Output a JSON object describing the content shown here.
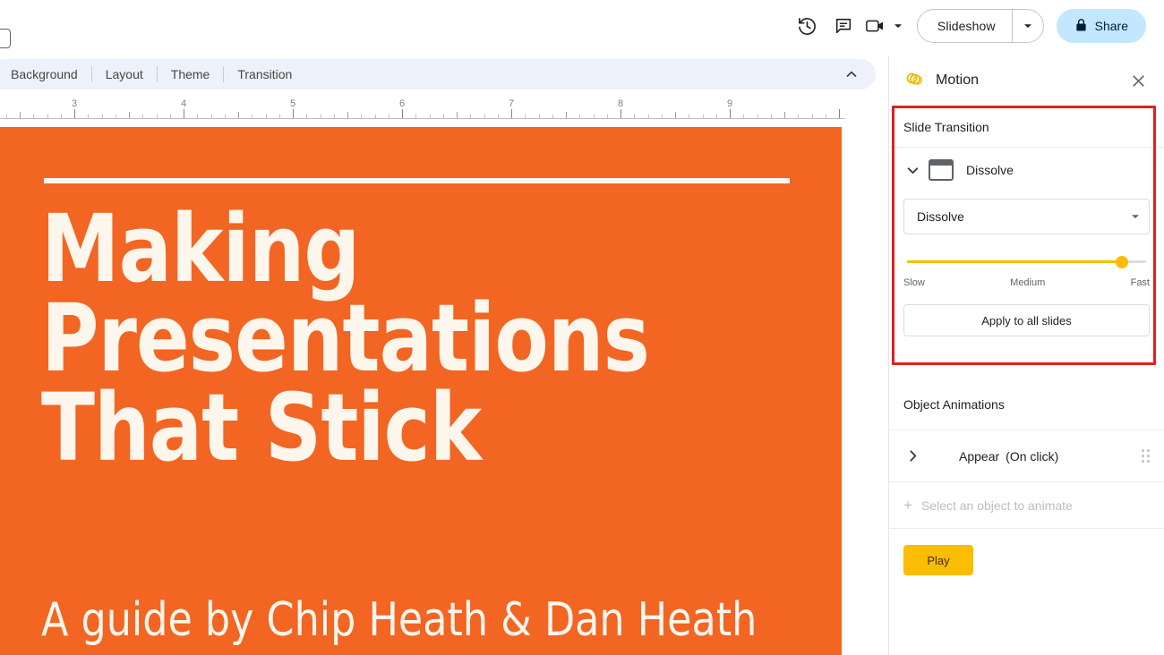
{
  "topbar": {
    "icons": [
      {
        "name": "version-history-icon",
        "label": "Version history"
      },
      {
        "name": "comment-icon",
        "label": "Comments"
      },
      {
        "name": "meet-camera-icon",
        "label": "Join call"
      }
    ],
    "present_label": "Slideshow",
    "present_caret_label": "▾",
    "share_label": "Share",
    "share_bg": "#c2e7ff",
    "share_icon": "lock-icon"
  },
  "subbar": {
    "items": [
      {
        "label": "Background"
      },
      {
        "label": "Layout"
      },
      {
        "label": "Theme"
      },
      {
        "label": "Transition"
      }
    ],
    "collapse_icon": "chevron-up-icon",
    "bg": "#edf2fa"
  },
  "ruler": {
    "numbers": [
      "3",
      "4",
      "5",
      "6",
      "7",
      "8",
      "9"
    ],
    "unit": "inches"
  },
  "slide": {
    "background": "#f26522",
    "title": "Making Presentations That Stick",
    "subtitle": "A guide by Chip Heath & Dan Heath",
    "text_color": "#fdf6ec"
  },
  "panel": {
    "title": "Motion",
    "header_icon": "motion-icon",
    "close_icon": "close-icon",
    "slide_transition": {
      "section_label": "Slide Transition",
      "expand_icon": "chevron-down-icon",
      "type_icon": "transition-screen-icon",
      "type_label": "Dissolve",
      "select_value": "Dissolve",
      "select_caret_icon": "caret-down-icon",
      "speed": {
        "value_percent": 90,
        "labels": [
          "Slow",
          "Medium",
          "Fast"
        ],
        "track_color": "#f2c200",
        "thumb_color": "#f9bc07"
      },
      "apply_all_label": "Apply to all slides",
      "highlight_color": "#e02020"
    },
    "object_animations": {
      "section_label": "Object Animations",
      "animations": [
        {
          "expand_icon": "chevron-right-icon",
          "name": "Appear",
          "trigger": "(On click)",
          "drag_icon": "drag-handle-icon"
        }
      ],
      "add_label": "Select an object to animate",
      "add_icon": "plus-icon",
      "play_label": "Play",
      "play_bg": "#fbbc04"
    }
  }
}
